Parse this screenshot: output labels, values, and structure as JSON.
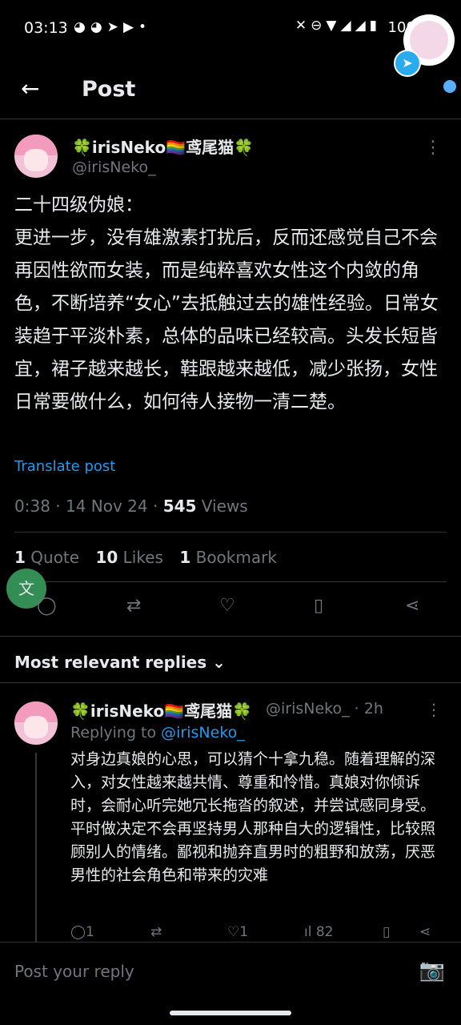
{
  "status_bar": {
    "time": "03:13",
    "left_icons": [
      "discord-icon",
      "discord-icon",
      "telegram-icon",
      "youtube-icon",
      "dot-icon"
    ],
    "right_icons": [
      "mute-icon",
      "dnd-icon",
      "wifi-icon",
      "signal-icon",
      "signal-icon",
      "battery-icon"
    ],
    "battery": "100%"
  },
  "header": {
    "title": "Post"
  },
  "post": {
    "author_name": "🍀irisNeko🏳️‍🌈鸢尾猫🍀",
    "author_handle": "@irisNeko_",
    "text": "二十四级伪娘：\n更进一步，没有雄激素打扰后，反而还感觉自己不会再因性欲而女装，而是纯粹喜欢女性这个内敛的角色，不断培养“女心”去抵触过去的雄性经验。日常女装趋于平淡朴素，总体的品味已经较高。头发长短皆宜，裙子越来越长，鞋跟越来越低，减少张扬，女性日常要做什么，如何待人接物一清二楚。",
    "translate": "Translate post",
    "time_date": "0:38 · 14 Nov 24 · ",
    "views_count": "545",
    "views_label": " Views",
    "stats": {
      "quotes_count": "1",
      "quotes_label": " Quote",
      "likes_count": "10",
      "likes_label": " Likes",
      "bookmarks_count": "1",
      "bookmarks_label": " Bookmark"
    }
  },
  "actions": [
    "reply-icon",
    "repost-icon",
    "like-icon",
    "bookmark-icon",
    "share-icon"
  ],
  "replies_sort": "Most relevant replies",
  "reply": {
    "author_name": "🍀irisNeko🏳️‍🌈鸢尾猫🍀",
    "handle_time": "@irisNeko_ · 2h",
    "replying_prefix": "Replying to ",
    "replying_handle": "@irisNeko_",
    "text": "对身边真娘的心思，可以猜个十拿九稳。随着理解的深入，对女性越来越共情、尊重和怜惜。真娘对你倾诉时，会耐心听完她冗长拖沓的叙述，并尝试感同身受。平时做决定不会再坚持男人那种自大的逻辑性，比较照顾别人的情绪。鄙视和抛弃直男时的粗野和放荡，厌恶男性的社会角色和带来的灾难",
    "replies": "1",
    "likes": "1",
    "views": "82"
  },
  "reply_input_placeholder": "Post your reply"
}
